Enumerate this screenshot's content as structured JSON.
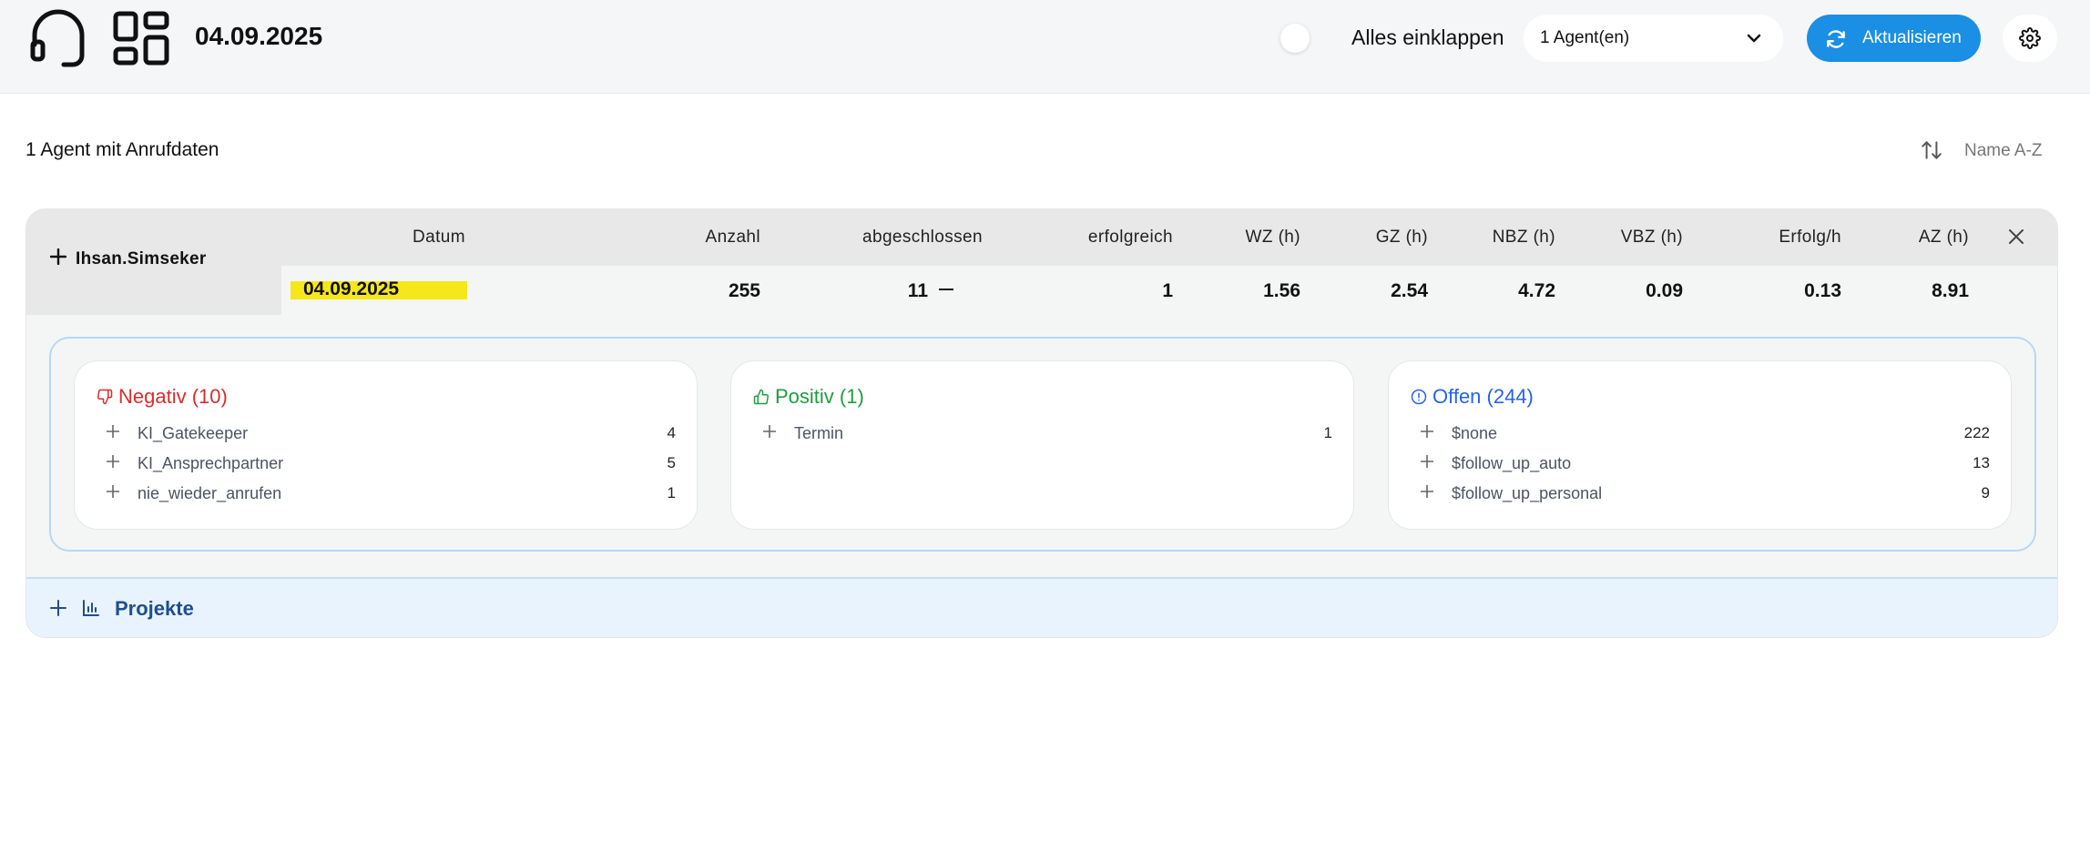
{
  "header": {
    "date": "04.09.2025",
    "collapse_label": "Alles einklappen",
    "agent_select": "1 Agent(en)",
    "refresh_label": "Aktualisieren"
  },
  "summary": {
    "count_label": "1 Agent mit Anrufdaten",
    "sort_label": "Name A-Z"
  },
  "table": {
    "agent_name": "Ihsan.Simseker",
    "columns": {
      "datum": "Datum",
      "anzahl": "Anzahl",
      "abgeschlossen": "abgeschlossen",
      "erfolgreich": "erfolgreich",
      "wz": "WZ (h)",
      "gz": "GZ (h)",
      "nbz": "NBZ (h)",
      "vbz": "VBZ (h)",
      "erfolg_h": "Erfolg/h",
      "az": "AZ (h)"
    },
    "row": {
      "datum": "04.09.2025",
      "anzahl": "255",
      "abgeschlossen": "11",
      "erfolgreich": "1",
      "wz": "1.56",
      "gz": "2.54",
      "nbz": "4.72",
      "vbz": "0.09",
      "erfolg_h": "0.13",
      "az": "8.91"
    }
  },
  "outcomes": {
    "negativ": {
      "title": "Negativ (10)",
      "color": "#d92d2d",
      "icon": "thumbs-down-icon",
      "items": [
        {
          "label": "KI_Gatekeeper",
          "count": "4"
        },
        {
          "label": "KI_Ansprechpartner",
          "count": "5"
        },
        {
          "label": "nie_wieder_anrufen",
          "count": "1"
        }
      ]
    },
    "positiv": {
      "title": "Positiv (1)",
      "color": "#1f9d3f",
      "icon": "thumbs-up-icon",
      "items": [
        {
          "label": "Termin",
          "count": "1"
        }
      ]
    },
    "offen": {
      "title": "Offen (244)",
      "color": "#2563eb",
      "icon": "info-circle-icon",
      "items": [
        {
          "label": "$none",
          "count": "222"
        },
        {
          "label": "$follow_up_auto",
          "count": "13"
        },
        {
          "label": "$follow_up_personal",
          "count": "9"
        }
      ]
    }
  },
  "projects": {
    "label": "Projekte"
  }
}
